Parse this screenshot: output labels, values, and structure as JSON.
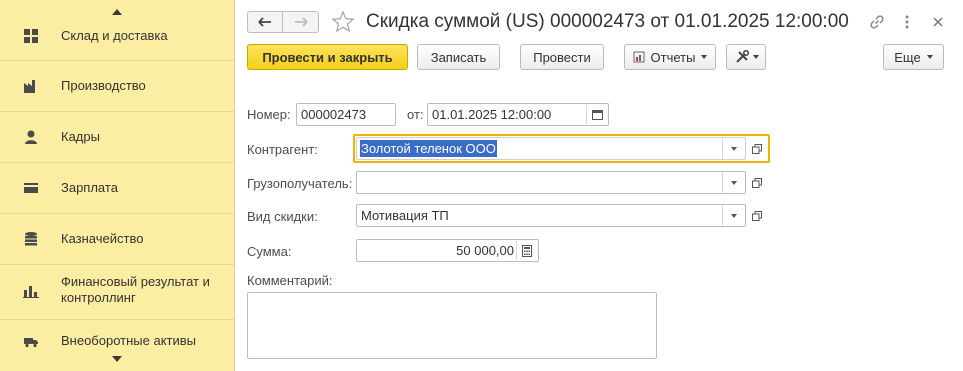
{
  "sidebar": {
    "items": [
      {
        "label": "Склад и доставка",
        "icon": "warehouse-icon"
      },
      {
        "label": "Производство",
        "icon": "factory-icon"
      },
      {
        "label": "Кадры",
        "icon": "person-icon"
      },
      {
        "label": "Зарплата",
        "icon": "wallet-icon"
      },
      {
        "label": "Казначейство",
        "icon": "coins-icon"
      },
      {
        "label": "Финансовый результат и контроллинг",
        "icon": "bar-chart-icon"
      },
      {
        "label": "Внеоборотные активы",
        "icon": "truck-icon"
      }
    ]
  },
  "window": {
    "title": "Скидка суммой (US) 000002473 от 01.01.2025 12:00:00"
  },
  "toolbar": {
    "post_close_label": "Провести и закрыть",
    "save_label": "Записать",
    "post_label": "Провести",
    "reports_label": "Отчеты",
    "more_label": "Еще"
  },
  "form": {
    "number_label": "Номер:",
    "number_value": "000002473",
    "date_label": "от:",
    "date_value": "01.01.2025 12:00:00",
    "counterparty_label": "Контрагент:",
    "counterparty_value": "Золотой теленок ООО",
    "consignee_label": "Грузополучатель:",
    "consignee_value": "",
    "discount_type_label": "Вид скидки:",
    "discount_type_value": "Мотивация ТП",
    "amount_label": "Сумма:",
    "amount_value": "50 000,00",
    "comment_label": "Комментарий:",
    "comment_value": ""
  },
  "colors": {
    "sidebar_bg": "#fbeda1",
    "primary_button": "#f5cf1a",
    "focus_border": "#f0b400",
    "selection": "#3b6cc9"
  }
}
